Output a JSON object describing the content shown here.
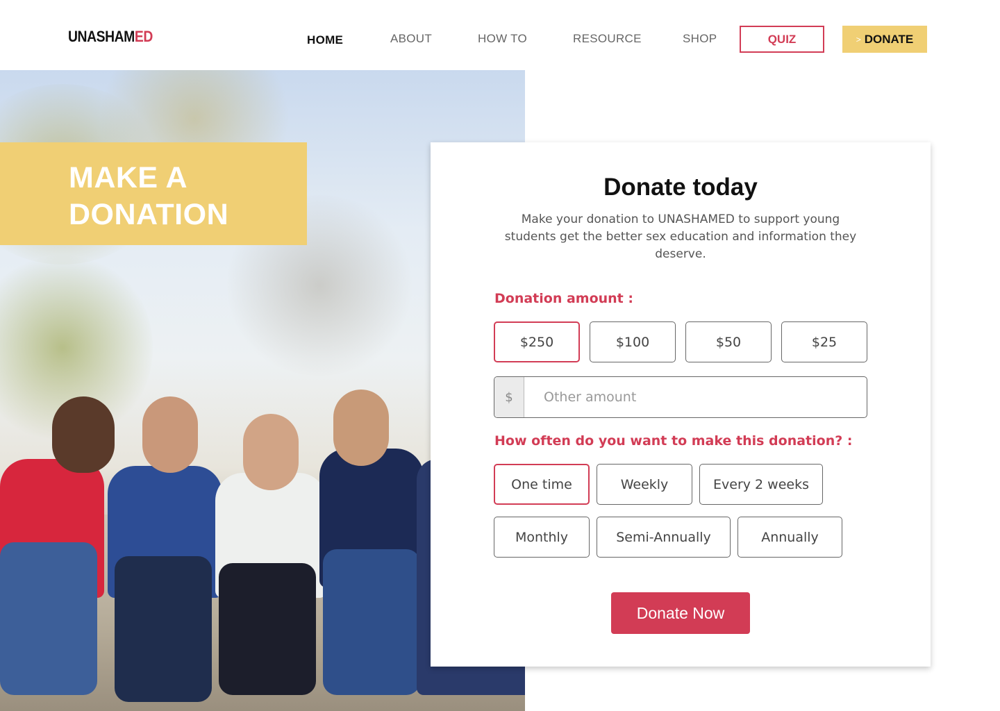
{
  "header": {
    "logo_part1": "UNASHAM",
    "logo_part2": "ED",
    "nav": [
      "HOME",
      "ABOUT",
      "HOW TO",
      "RESOURCE",
      "SHOP"
    ],
    "quiz_label": "QUIZ",
    "donate_arrow": ">",
    "donate_label": "DONATE"
  },
  "hero": {
    "title_line1": "MAKE A",
    "title_line2": "DONATION"
  },
  "card": {
    "title": "Donate today",
    "description": "Make your donation to UNASHAMED to support young students get the better sex education and information they deserve.",
    "amount_label": "Donation amount :",
    "amounts": [
      "$250",
      "$100",
      "$50",
      "$25"
    ],
    "selected_amount": "$250",
    "other_prefix": "$",
    "other_placeholder": "Other amount",
    "frequency_label": "How often do you want to make this donation? :",
    "frequencies": [
      "One time",
      "Weekly",
      "Every 2 weeks",
      "Monthly",
      "Semi-Annually",
      "Annually"
    ],
    "selected_frequency": "One time",
    "submit_label": "Donate Now"
  },
  "colors": {
    "accent": "#d23c55",
    "yellow": "#f0cf74"
  }
}
